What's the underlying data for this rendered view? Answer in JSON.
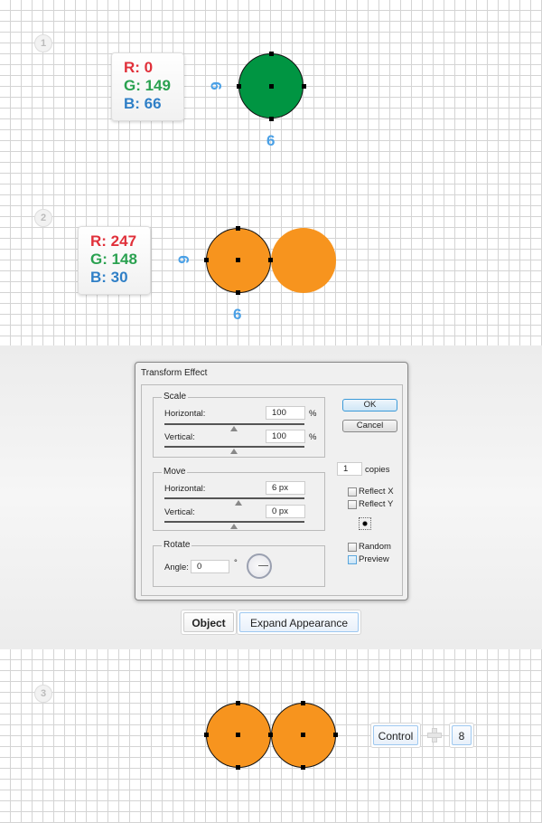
{
  "steps": [
    "1",
    "2",
    "3"
  ],
  "step1": {
    "color": {
      "r": "R: 0",
      "g": "G: 149",
      "b": "B: 66"
    },
    "fill": "#009542",
    "dim_w": "6",
    "dim_h": "6"
  },
  "step2": {
    "color": {
      "r": "R: 247",
      "g": "G: 148",
      "b": "B: 30"
    },
    "fill": "#f7941e",
    "dim_w": "6",
    "dim_h": "6"
  },
  "dialog": {
    "title": "Transform Effect",
    "scale": {
      "legend": "Scale",
      "horizontal_label": "Horizontal:",
      "horizontal_value": "100",
      "vertical_label": "Vertical:",
      "vertical_value": "100",
      "unit": "%"
    },
    "move": {
      "legend": "Move",
      "horizontal_label": "Horizontal:",
      "horizontal_value": "6 px",
      "vertical_label": "Vertical:",
      "vertical_value": "0 px"
    },
    "rotate": {
      "legend": "Rotate",
      "angle_label": "Angle:",
      "angle_value": "0",
      "unit": "°"
    },
    "ok": "OK",
    "cancel": "Cancel",
    "copies_value": "1",
    "copies_label": "copies",
    "reflect_x": "Reflect X",
    "reflect_y": "Reflect Y",
    "random": "Random",
    "preview": "Preview"
  },
  "menu_path": {
    "object": "Object",
    "expand": "Expand Appearance"
  },
  "shortcut": {
    "modifier": "Control",
    "key": "8"
  }
}
